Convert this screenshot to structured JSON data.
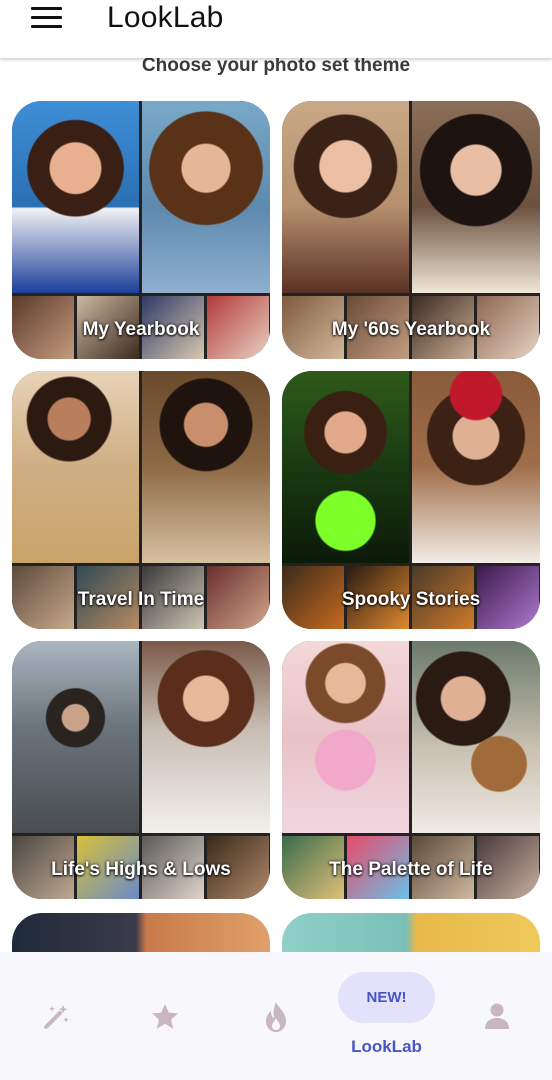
{
  "app": {
    "title": "LookLab",
    "subtitle": "Choose your photo set theme"
  },
  "themes": [
    {
      "label": "My Yearbook"
    },
    {
      "label": "My '60s Yearbook"
    },
    {
      "label": "Travel In Time"
    },
    {
      "label": "Spooky Stories"
    },
    {
      "label": "Life's Highs & Lows"
    },
    {
      "label": "The Palette of Life"
    }
  ],
  "bottom_nav": {
    "items": [
      {
        "icon": "magic-wand-icon"
      },
      {
        "icon": "star-icon"
      },
      {
        "icon": "flame-icon"
      },
      {
        "badge": "NEW!",
        "label": "LookLab",
        "active": true
      },
      {
        "icon": "person-icon"
      }
    ]
  },
  "colors": {
    "accent": "#4a54c9",
    "pill": "#e4e2fb",
    "nav_icon": "#c8b7c0"
  }
}
